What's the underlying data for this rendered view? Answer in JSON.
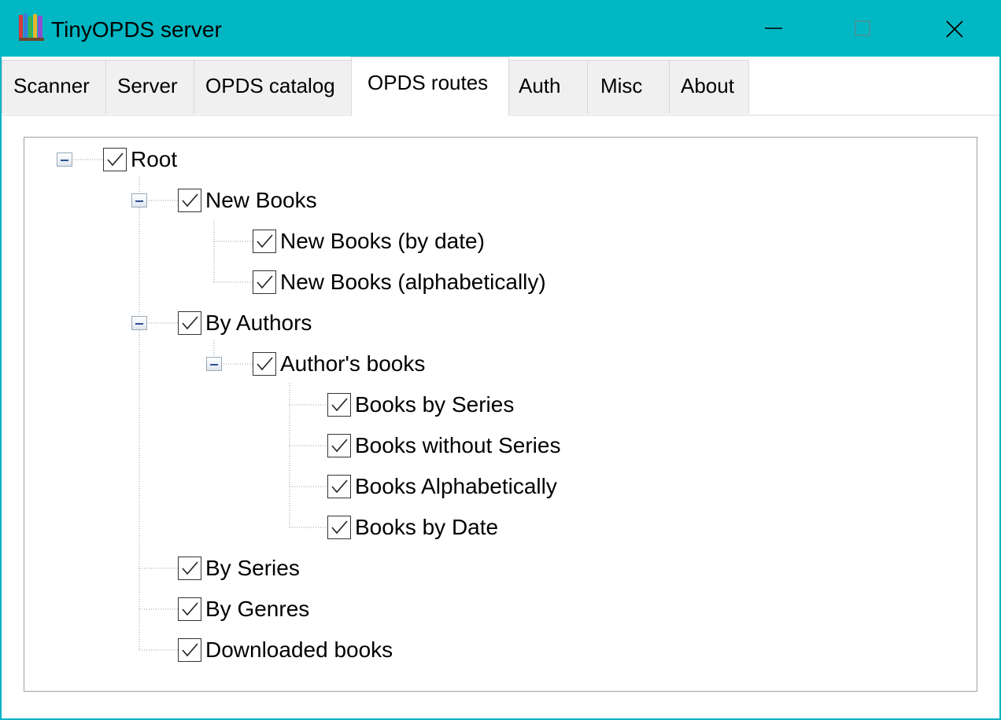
{
  "window": {
    "title": "TinyOPDS server",
    "controls": {
      "minimize": "minimize",
      "maximize": "maximize",
      "close": "close"
    },
    "colors": {
      "titlebar": "#00b7c3",
      "border": "#00b4c4"
    }
  },
  "tabs": [
    {
      "label": "Scanner",
      "active": false
    },
    {
      "label": "Server",
      "active": false
    },
    {
      "label": "OPDS catalog",
      "active": false
    },
    {
      "label": "OPDS routes",
      "active": true
    },
    {
      "label": "Auth",
      "active": false
    },
    {
      "label": "Misc",
      "active": false
    },
    {
      "label": "About",
      "active": false
    }
  ],
  "tree": [
    {
      "label": "Root",
      "level": 0,
      "checked": true,
      "expanded": true
    },
    {
      "label": "New Books",
      "level": 1,
      "checked": true,
      "expanded": true
    },
    {
      "label": "New Books (by date)",
      "level": 2,
      "checked": true
    },
    {
      "label": "New Books (alphabetically)",
      "level": 2,
      "checked": true
    },
    {
      "label": "By Authors",
      "level": 1,
      "checked": true,
      "expanded": true
    },
    {
      "label": "Author's books",
      "level": 2,
      "checked": true,
      "expanded": true
    },
    {
      "label": "Books by Series",
      "level": 3,
      "checked": true
    },
    {
      "label": "Books without Series",
      "level": 3,
      "checked": true
    },
    {
      "label": "Books Alphabetically",
      "level": 3,
      "checked": true
    },
    {
      "label": "Books by Date",
      "level": 3,
      "checked": true
    },
    {
      "label": "By Series",
      "level": 1,
      "checked": true
    },
    {
      "label": "By Genres",
      "level": 1,
      "checked": true
    },
    {
      "label": "Downloaded books",
      "level": 1,
      "checked": true
    }
  ]
}
